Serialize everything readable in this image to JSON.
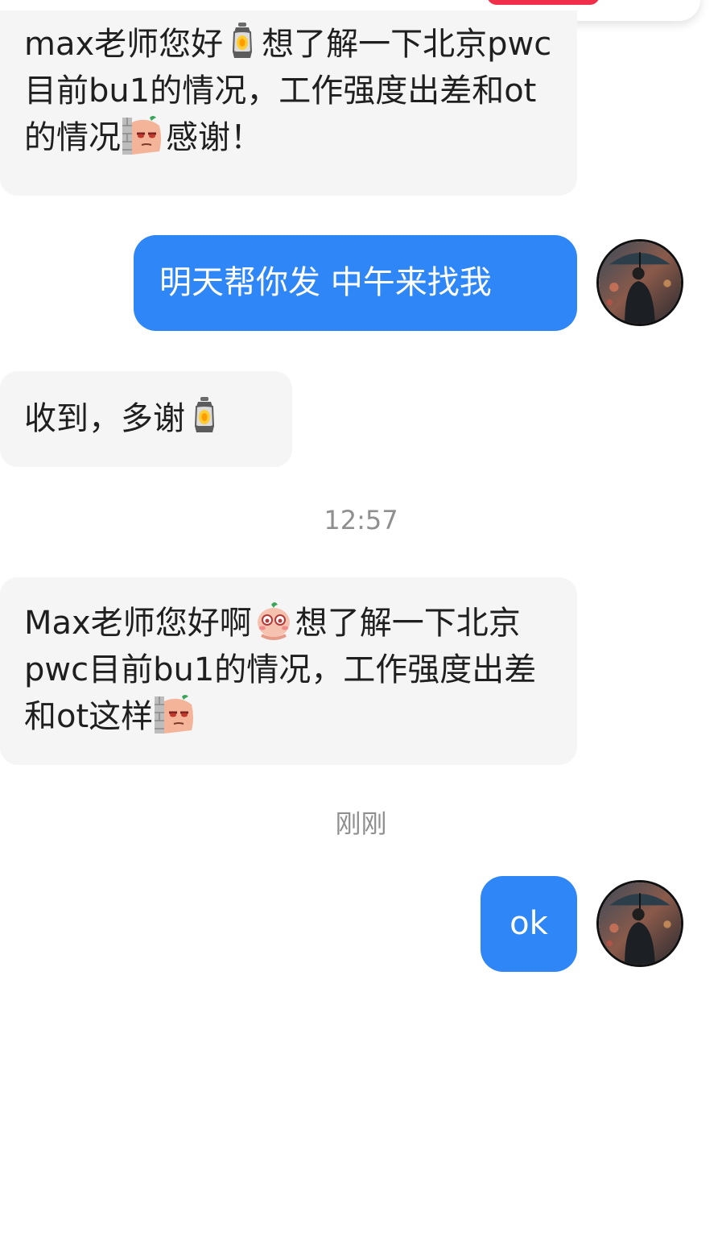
{
  "messages": [
    {
      "direction": "incoming",
      "parts": [
        "max老师您好",
        "想了解一下北京pwc目前bu1的情况，工作强度出差和ot的情况",
        "感谢！"
      ],
      "emojis": [
        "lantern-emoji",
        "peeking-wall-emoji"
      ]
    },
    {
      "direction": "outgoing",
      "text": "明天帮你发 中午来找我"
    },
    {
      "direction": "incoming",
      "parts": [
        "收到，多谢"
      ],
      "emojis": [
        "lantern-emoji"
      ]
    },
    {
      "direction": "incoming",
      "parts": [
        "Max老师您好啊",
        "想了解一下北京pwc目前bu1的情况，工作强度出差和ot这样"
      ],
      "emojis": [
        "blushing-face-emoji",
        "peeking-wall-emoji"
      ]
    },
    {
      "direction": "outgoing",
      "text": "ok"
    }
  ],
  "timestamps": [
    "12:57",
    "刚刚"
  ],
  "colors": {
    "outgoing_bubble": "#2f86f6",
    "incoming_bubble": "#f5f5f5",
    "timestamp_text": "#8f8f8f",
    "top_accent": "#f0304a"
  },
  "avatar": {
    "icon": "person-with-umbrella-avatar"
  }
}
